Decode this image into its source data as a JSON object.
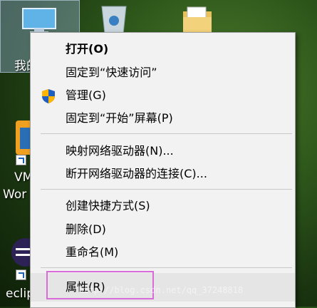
{
  "desktop": {
    "icons": [
      {
        "label": "我的",
        "name": "this-pc"
      },
      {
        "label": "VM",
        "name": "vmware-line1"
      },
      {
        "label": "Wor",
        "name": "vmware-line2"
      },
      {
        "label": "eclipse",
        "name": "eclipse"
      },
      {
        "label": "回收站",
        "name": "recycle-bin"
      }
    ],
    "partial_labels": {
      "bottom_right": "..."
    }
  },
  "context_menu": {
    "items": [
      {
        "label": "打开(O)",
        "bold": true
      },
      {
        "label": "固定到“快速访问”"
      },
      {
        "label": "管理(G)",
        "icon": "uac-shield-icon"
      },
      {
        "label": "固定到“开始”屏幕(P)"
      },
      {
        "label": "映射网络驱动器(N)..."
      },
      {
        "label": "断开网络驱动器的连接(C)..."
      },
      {
        "label": "创建快捷方式(S)"
      },
      {
        "label": "删除(D)"
      },
      {
        "label": "重命名(M)"
      },
      {
        "label": "属性(R)",
        "highlighted": true
      }
    ]
  },
  "watermark": "http://blog.csdn.net/qq_37248818",
  "colors": {
    "menu_bg": "#f2f2f2",
    "highlight_border": "#d86bd8",
    "hover_bg": "#e5e5e5"
  }
}
